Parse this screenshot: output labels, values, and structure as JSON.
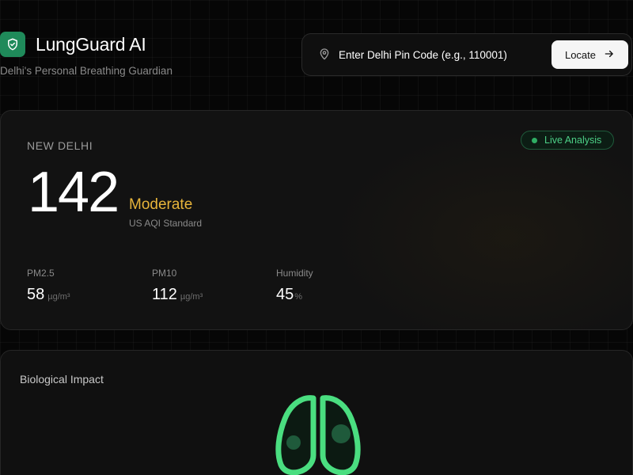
{
  "header": {
    "app_title": "LungGuard AI",
    "subtitle": "Delhi's Personal Breathing Guardian",
    "logo_icon": "shield-check-icon",
    "logo_color": "#1f8a5a"
  },
  "search": {
    "placeholder": "Enter Delhi Pin Code (e.g., 110001)",
    "button_label": "Locate",
    "pin_icon": "map-pin-icon",
    "button_icon": "arrow-right-icon"
  },
  "aqi": {
    "city": "NEW DELHI",
    "live_label": "Live Analysis",
    "value": "142",
    "category": "Moderate",
    "category_color": "#e7b43a",
    "standard": "US AQI Standard",
    "metrics": [
      {
        "label": "PM2.5",
        "value": "58",
        "unit": "µg/m³"
      },
      {
        "label": "PM10",
        "value": "112",
        "unit": "µg/m³"
      },
      {
        "label": "Humidity",
        "value": "45",
        "unit": "%"
      }
    ]
  },
  "impact": {
    "title": "Biological Impact",
    "illustration_icon": "lungs-icon",
    "accent_color": "#4ade80"
  }
}
